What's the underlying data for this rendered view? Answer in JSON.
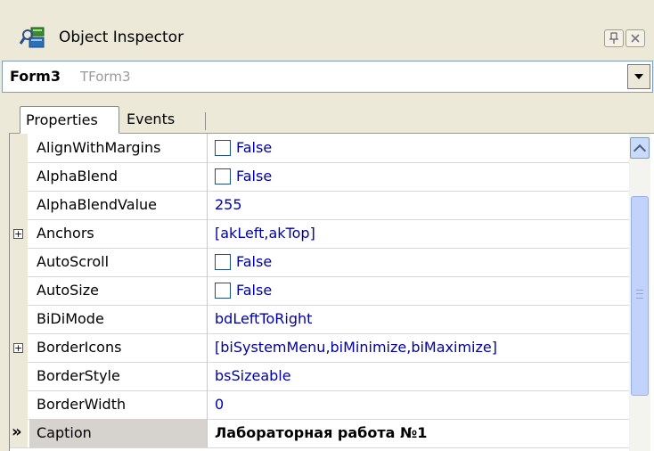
{
  "window": {
    "title": "Object Inspector",
    "icon": "object-inspector-icon",
    "pin_icon": "pin-icon",
    "close_icon": "close-icon"
  },
  "selector": {
    "component_name": "Form3",
    "component_type": "TForm3"
  },
  "tabs": [
    {
      "label": "Properties",
      "active": true
    },
    {
      "label": "Events",
      "active": false
    }
  ],
  "properties": [
    {
      "name": "AlignWithMargins",
      "value": "False",
      "checkbox": true
    },
    {
      "name": "AlphaBlend",
      "value": "False",
      "checkbox": true
    },
    {
      "name": "AlphaBlendValue",
      "value": "255"
    },
    {
      "name": "Anchors",
      "value": "[akLeft,akTop]",
      "expandable": true
    },
    {
      "name": "AutoScroll",
      "value": "False",
      "checkbox": true
    },
    {
      "name": "AutoSize",
      "value": "False",
      "checkbox": true
    },
    {
      "name": "BiDiMode",
      "value": "bdLeftToRight"
    },
    {
      "name": "BorderIcons",
      "value": "[biSystemMenu,biMinimize,biMaximize]",
      "expandable": true
    },
    {
      "name": "BorderStyle",
      "value": "bsSizeable"
    },
    {
      "name": "BorderWidth",
      "value": "0"
    },
    {
      "name": "Caption",
      "value": "Лабораторная работа №1",
      "selected": true,
      "marker": "»"
    }
  ],
  "colors": {
    "value_text": "#0000a8",
    "background": "#ece9d8"
  }
}
